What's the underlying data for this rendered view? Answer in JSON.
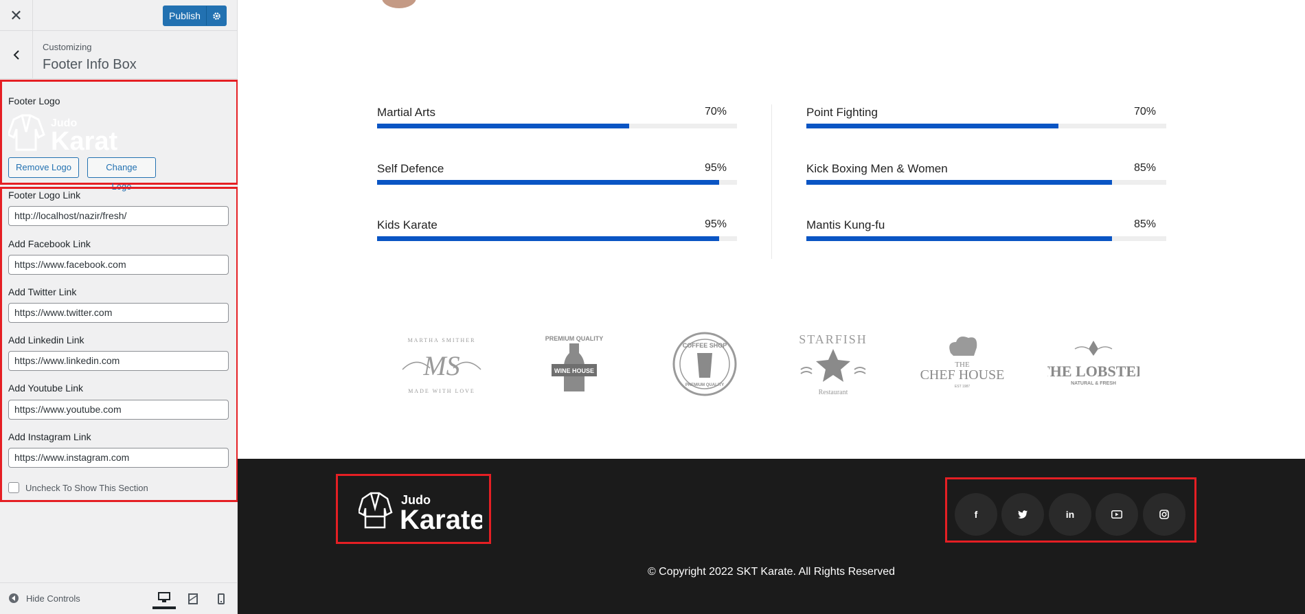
{
  "customizer": {
    "publish_label": "Publish",
    "breadcrumb_small": "Customizing",
    "breadcrumb_title": "Footer Info Box",
    "footer_logo_label": "Footer Logo",
    "logo_small": "Judo",
    "logo_big": "Karate",
    "remove_logo": "Remove Logo",
    "change_logo": "Change Logo",
    "fields": [
      {
        "label": "Footer Logo Link",
        "value": "http://localhost/nazir/fresh/"
      },
      {
        "label": "Add Facebook Link",
        "value": "https://www.facebook.com"
      },
      {
        "label": "Add Twitter Link",
        "value": "https://www.twitter.com"
      },
      {
        "label": "Add Linkedin Link",
        "value": "https://www.linkedin.com"
      },
      {
        "label": "Add Youtube Link",
        "value": "https://www.youtube.com"
      },
      {
        "label": "Add Instagram Link",
        "value": "https://www.instagram.com"
      }
    ],
    "checkbox_label": "Uncheck To Show This Section",
    "hide_controls": "Hide Controls"
  },
  "skills": [
    {
      "name": "Martial Arts",
      "percent_label": "70%",
      "value": 70
    },
    {
      "name": "Point Fighting",
      "percent_label": "70%",
      "value": 70
    },
    {
      "name": "Self Defence",
      "percent_label": "95%",
      "value": 95
    },
    {
      "name": "Kick Boxing Men & Women",
      "percent_label": "85%",
      "value": 85
    },
    {
      "name": "Kids Karate",
      "percent_label": "95%",
      "value": 95
    },
    {
      "name": "Mantis Kung-fu",
      "percent_label": "85%",
      "value": 85
    }
  ],
  "brands": [
    {
      "top": "MARTHA SMITHER",
      "main": "MS",
      "bottom": "MADE WITH LOVE"
    },
    {
      "top": "PREMIUM QUALITY",
      "main": "WINE HOUSE",
      "bottom": ""
    },
    {
      "top": "COFFEE SHOP",
      "main": "",
      "bottom": "PREMIUM QUALITY"
    },
    {
      "top": "STARFISH",
      "main": "",
      "bottom": "Restaurant"
    },
    {
      "top": "THE",
      "main": "CHEF HOUSE",
      "bottom": "EST 1987"
    },
    {
      "top": "",
      "main": "THE LOBSTER",
      "bottom": "NATURAL & FRESH"
    }
  ],
  "site_footer": {
    "logo_small": "Judo",
    "logo_big": "Karate",
    "social": [
      "f",
      "t",
      "in",
      "yt",
      "ig"
    ],
    "copyright": "© Copyright 2022 SKT Karate. All Rights Reserved"
  },
  "colors": {
    "accent": "#2271b1",
    "progress": "#0a55c4",
    "highlight": "#e51f24",
    "footer_bg": "#1b1b1b"
  }
}
